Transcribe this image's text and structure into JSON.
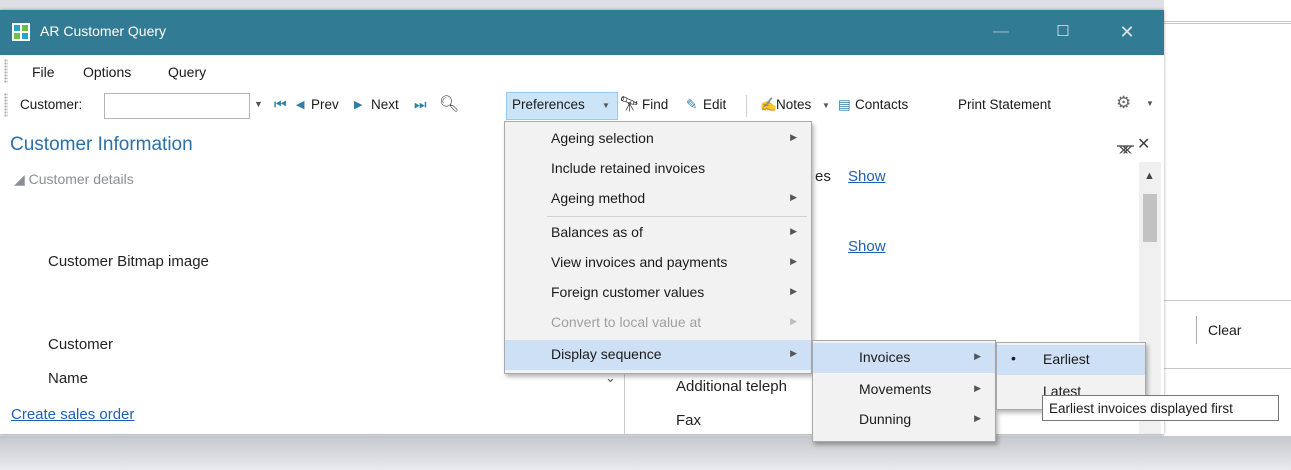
{
  "window": {
    "title": "AR Customer Query",
    "controls": {
      "minimize": "—",
      "maximize": "☐",
      "close": "✕"
    }
  },
  "menubar": {
    "items": [
      "File",
      "Options",
      "Query"
    ]
  },
  "toolbar": {
    "customer_label": "Customer:",
    "customer_value": "",
    "prev": "Prev",
    "next": "Next",
    "preferences": "Preferences",
    "find": "Find",
    "edit": "Edit",
    "notes": "Notes",
    "contacts": "Contacts",
    "print_statement": "Print Statement"
  },
  "panel": {
    "title": "Customer Information",
    "section": "Customer details",
    "fields": {
      "bitmap": "Customer Bitmap image",
      "customer": "Customer",
      "name": "Name"
    },
    "link_create_order": "Create sales order",
    "partial_es": "es",
    "show1": "Show",
    "show2": "Show",
    "right_fields": {
      "additional_telephone": "Additional teleph",
      "fax": "Fax"
    },
    "clear": "Clear"
  },
  "preferences_menu": {
    "items": [
      {
        "label": "Ageing selection",
        "submenu": true,
        "disabled": false
      },
      {
        "label": "Include retained invoices",
        "submenu": false,
        "disabled": false
      },
      {
        "label": "Ageing method",
        "submenu": true,
        "disabled": false
      },
      {
        "label": "Balances as of",
        "submenu": true,
        "disabled": false
      },
      {
        "label": "View invoices and payments",
        "submenu": true,
        "disabled": false
      },
      {
        "label": "Foreign customer values",
        "submenu": true,
        "disabled": false
      },
      {
        "label": "Convert to local value at",
        "submenu": true,
        "disabled": true
      },
      {
        "label": "Display sequence",
        "submenu": true,
        "disabled": false,
        "highlighted": true
      }
    ]
  },
  "display_sequence_menu": {
    "items": [
      {
        "label": "Invoices",
        "highlighted": true
      },
      {
        "label": "Movements"
      },
      {
        "label": "Dunning"
      }
    ]
  },
  "invoices_menu": {
    "items": [
      {
        "label": "Earliest",
        "selected": true
      },
      {
        "label": "Latest"
      }
    ]
  },
  "tooltip": "Earliest invoices displayed first",
  "colors": {
    "titlebar": "#327b94",
    "accent_blue": "#2a6fa8",
    "highlight": "#cde0f5"
  }
}
